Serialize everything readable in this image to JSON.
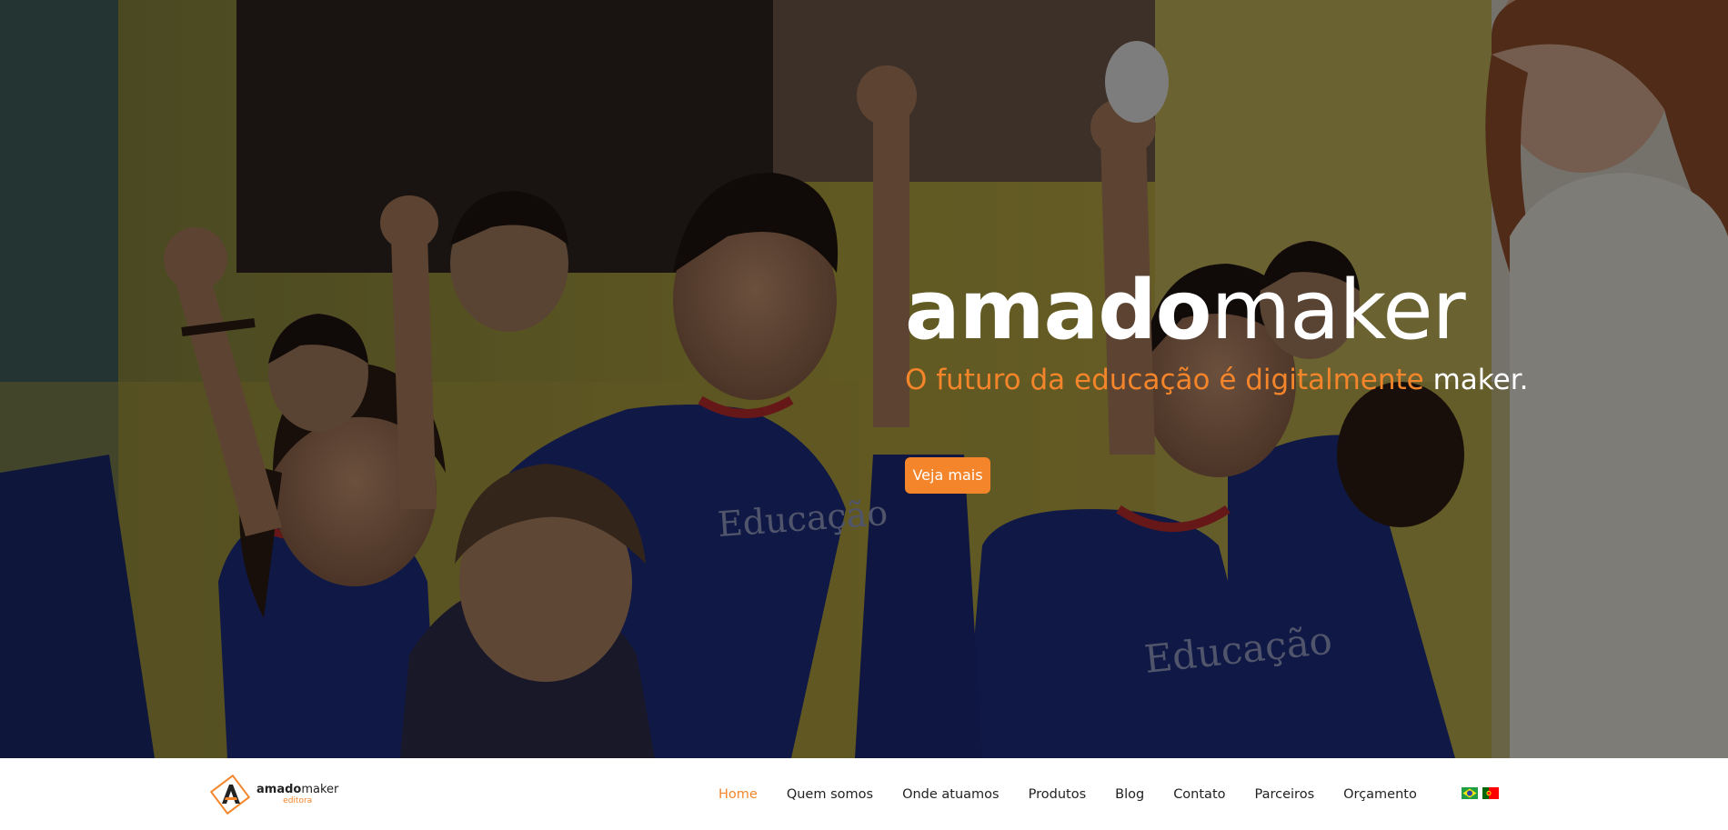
{
  "hero": {
    "brand_bold": "amado",
    "brand_light": "maker",
    "tagline_orange": "O futuro da educação é digitalmente",
    "tagline_white": "maker.",
    "cta_label": "Veja mais",
    "photo_shirt_text": "Educação"
  },
  "nav": {
    "logo": {
      "name_bold": "amado",
      "name_light": "maker",
      "sub": "editora"
    },
    "items": [
      {
        "label": "Home",
        "active": true
      },
      {
        "label": "Quem somos"
      },
      {
        "label": "Onde atuamos"
      },
      {
        "label": "Produtos"
      },
      {
        "label": "Blog"
      },
      {
        "label": "Contato"
      },
      {
        "label": "Parceiros"
      },
      {
        "label": "Orçamento"
      }
    ],
    "flags": [
      "brazil-flag-icon",
      "portugal-flag-icon"
    ]
  },
  "colors": {
    "accent": "#f4852a",
    "text_dark": "#222222",
    "shirt_blue": "#1c2a78"
  }
}
